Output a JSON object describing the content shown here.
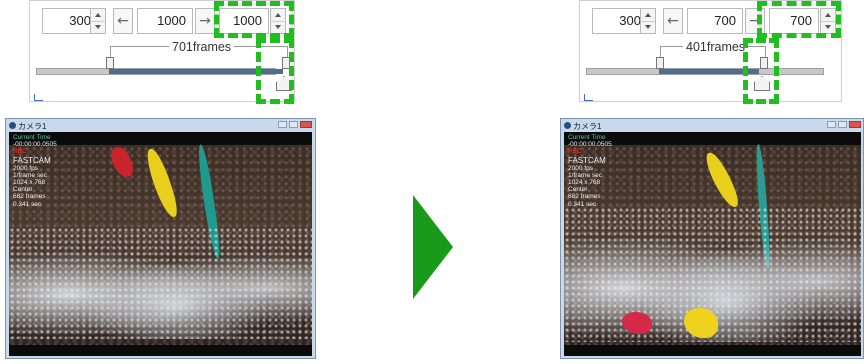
{
  "left": {
    "start_value": "300",
    "end_value": "1000",
    "end_display": "1000",
    "prev_arrow": "←",
    "next_arrow": "→",
    "frames_label": "701frames",
    "camera": {
      "title": "カメラ1",
      "osd_current_label": "Current  Time",
      "osd_time": "-00:00:00.0505",
      "osd_red": "REC",
      "osd_lines": [
        "FASTCAM",
        "2000 fps",
        "1/frame sec",
        "1024 x 768",
        "Center",
        "682 frames",
        "0.341 sec"
      ]
    }
  },
  "right": {
    "start_value": "300",
    "end_value": "700",
    "end_display": "700",
    "prev_arrow": "←",
    "next_arrow": "→",
    "frames_label": "401frames",
    "camera": {
      "title": "カメラ1",
      "osd_current_label": "Current  Time",
      "osd_time": "-00:00:00.0505",
      "osd_red": "REC",
      "osd_lines": [
        "FASTCAM",
        "2000 fps",
        "1/frame sec",
        "1024 x 768",
        "Center",
        "682 frames",
        "0.341 sec"
      ]
    }
  },
  "colors": {
    "highlight": "#1fbf1f",
    "arrow": "#1a9a1a",
    "slider_selection": "#4b6e92"
  }
}
